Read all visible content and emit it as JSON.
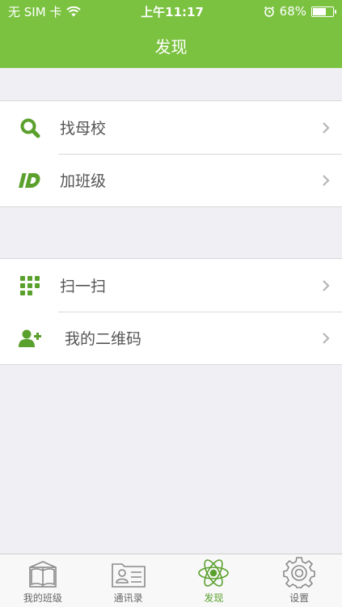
{
  "status_bar": {
    "carrier": "无 SIM 卡",
    "time": "上午11:17",
    "battery_percent": "68%",
    "battery_level": 0.68
  },
  "nav": {
    "title": "发现"
  },
  "groups": [
    {
      "items": [
        {
          "icon": "search-icon",
          "label": "找母校"
        },
        {
          "icon": "id-icon",
          "label": "加班级"
        }
      ]
    },
    {
      "items": [
        {
          "icon": "grid-icon",
          "label": "扫一扫"
        },
        {
          "icon": "add-person-icon",
          "label": "我的二维码"
        }
      ]
    }
  ],
  "tabbar": {
    "active": "发现",
    "tabs": [
      {
        "icon": "book-icon",
        "label": "我的班级"
      },
      {
        "icon": "contacts-icon",
        "label": "通讯录"
      },
      {
        "icon": "atom-icon",
        "label": "发现"
      },
      {
        "icon": "gear-icon",
        "label": "设置"
      }
    ]
  },
  "colors": {
    "accent": "#7bc241",
    "active_tab": "#5aa02c",
    "background": "#efeff4"
  }
}
